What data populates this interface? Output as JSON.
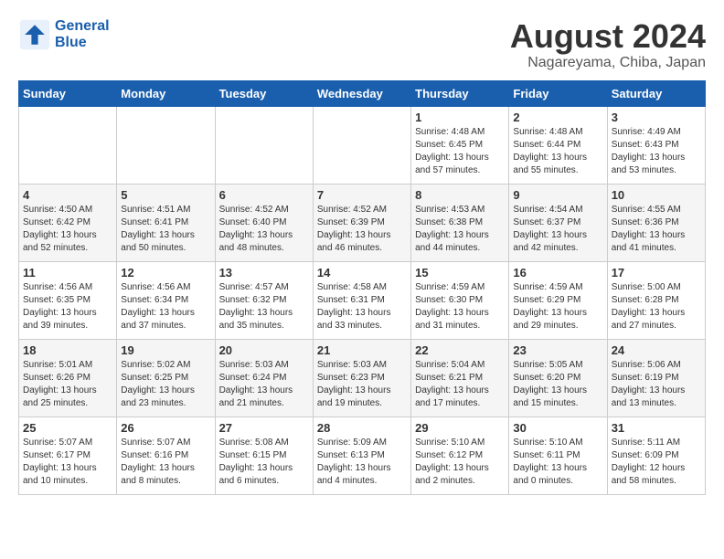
{
  "logo": {
    "line1": "General",
    "line2": "Blue"
  },
  "title": "August 2024",
  "location": "Nagareyama, Chiba, Japan",
  "weekdays": [
    "Sunday",
    "Monday",
    "Tuesday",
    "Wednesday",
    "Thursday",
    "Friday",
    "Saturday"
  ],
  "weeks": [
    [
      {
        "day": "",
        "info": ""
      },
      {
        "day": "",
        "info": ""
      },
      {
        "day": "",
        "info": ""
      },
      {
        "day": "",
        "info": ""
      },
      {
        "day": "1",
        "info": "Sunrise: 4:48 AM\nSunset: 6:45 PM\nDaylight: 13 hours\nand 57 minutes."
      },
      {
        "day": "2",
        "info": "Sunrise: 4:48 AM\nSunset: 6:44 PM\nDaylight: 13 hours\nand 55 minutes."
      },
      {
        "day": "3",
        "info": "Sunrise: 4:49 AM\nSunset: 6:43 PM\nDaylight: 13 hours\nand 53 minutes."
      }
    ],
    [
      {
        "day": "4",
        "info": "Sunrise: 4:50 AM\nSunset: 6:42 PM\nDaylight: 13 hours\nand 52 minutes."
      },
      {
        "day": "5",
        "info": "Sunrise: 4:51 AM\nSunset: 6:41 PM\nDaylight: 13 hours\nand 50 minutes."
      },
      {
        "day": "6",
        "info": "Sunrise: 4:52 AM\nSunset: 6:40 PM\nDaylight: 13 hours\nand 48 minutes."
      },
      {
        "day": "7",
        "info": "Sunrise: 4:52 AM\nSunset: 6:39 PM\nDaylight: 13 hours\nand 46 minutes."
      },
      {
        "day": "8",
        "info": "Sunrise: 4:53 AM\nSunset: 6:38 PM\nDaylight: 13 hours\nand 44 minutes."
      },
      {
        "day": "9",
        "info": "Sunrise: 4:54 AM\nSunset: 6:37 PM\nDaylight: 13 hours\nand 42 minutes."
      },
      {
        "day": "10",
        "info": "Sunrise: 4:55 AM\nSunset: 6:36 PM\nDaylight: 13 hours\nand 41 minutes."
      }
    ],
    [
      {
        "day": "11",
        "info": "Sunrise: 4:56 AM\nSunset: 6:35 PM\nDaylight: 13 hours\nand 39 minutes."
      },
      {
        "day": "12",
        "info": "Sunrise: 4:56 AM\nSunset: 6:34 PM\nDaylight: 13 hours\nand 37 minutes."
      },
      {
        "day": "13",
        "info": "Sunrise: 4:57 AM\nSunset: 6:32 PM\nDaylight: 13 hours\nand 35 minutes."
      },
      {
        "day": "14",
        "info": "Sunrise: 4:58 AM\nSunset: 6:31 PM\nDaylight: 13 hours\nand 33 minutes."
      },
      {
        "day": "15",
        "info": "Sunrise: 4:59 AM\nSunset: 6:30 PM\nDaylight: 13 hours\nand 31 minutes."
      },
      {
        "day": "16",
        "info": "Sunrise: 4:59 AM\nSunset: 6:29 PM\nDaylight: 13 hours\nand 29 minutes."
      },
      {
        "day": "17",
        "info": "Sunrise: 5:00 AM\nSunset: 6:28 PM\nDaylight: 13 hours\nand 27 minutes."
      }
    ],
    [
      {
        "day": "18",
        "info": "Sunrise: 5:01 AM\nSunset: 6:26 PM\nDaylight: 13 hours\nand 25 minutes."
      },
      {
        "day": "19",
        "info": "Sunrise: 5:02 AM\nSunset: 6:25 PM\nDaylight: 13 hours\nand 23 minutes."
      },
      {
        "day": "20",
        "info": "Sunrise: 5:03 AM\nSunset: 6:24 PM\nDaylight: 13 hours\nand 21 minutes."
      },
      {
        "day": "21",
        "info": "Sunrise: 5:03 AM\nSunset: 6:23 PM\nDaylight: 13 hours\nand 19 minutes."
      },
      {
        "day": "22",
        "info": "Sunrise: 5:04 AM\nSunset: 6:21 PM\nDaylight: 13 hours\nand 17 minutes."
      },
      {
        "day": "23",
        "info": "Sunrise: 5:05 AM\nSunset: 6:20 PM\nDaylight: 13 hours\nand 15 minutes."
      },
      {
        "day": "24",
        "info": "Sunrise: 5:06 AM\nSunset: 6:19 PM\nDaylight: 13 hours\nand 13 minutes."
      }
    ],
    [
      {
        "day": "25",
        "info": "Sunrise: 5:07 AM\nSunset: 6:17 PM\nDaylight: 13 hours\nand 10 minutes."
      },
      {
        "day": "26",
        "info": "Sunrise: 5:07 AM\nSunset: 6:16 PM\nDaylight: 13 hours\nand 8 minutes."
      },
      {
        "day": "27",
        "info": "Sunrise: 5:08 AM\nSunset: 6:15 PM\nDaylight: 13 hours\nand 6 minutes."
      },
      {
        "day": "28",
        "info": "Sunrise: 5:09 AM\nSunset: 6:13 PM\nDaylight: 13 hours\nand 4 minutes."
      },
      {
        "day": "29",
        "info": "Sunrise: 5:10 AM\nSunset: 6:12 PM\nDaylight: 13 hours\nand 2 minutes."
      },
      {
        "day": "30",
        "info": "Sunrise: 5:10 AM\nSunset: 6:11 PM\nDaylight: 13 hours\nand 0 minutes."
      },
      {
        "day": "31",
        "info": "Sunrise: 5:11 AM\nSunset: 6:09 PM\nDaylight: 12 hours\nand 58 minutes."
      }
    ]
  ]
}
